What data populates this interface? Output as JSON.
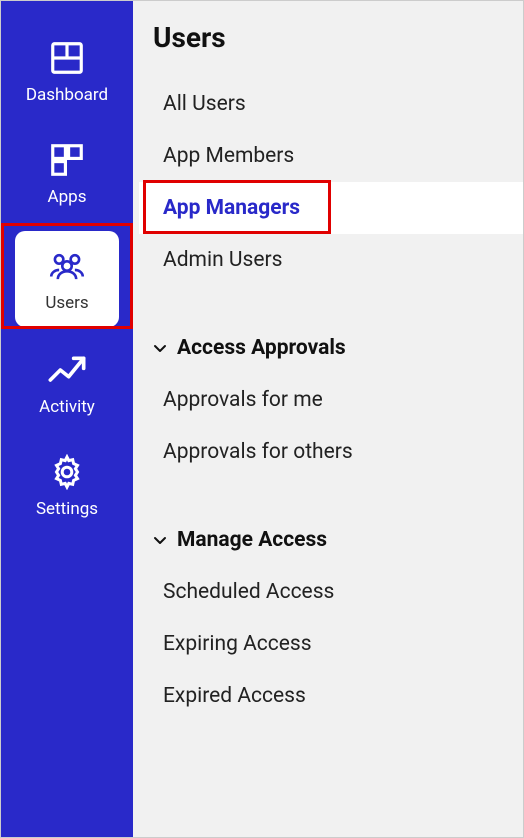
{
  "sidebar": {
    "items": [
      {
        "label": "Dashboard",
        "icon": "dashboard-icon"
      },
      {
        "label": "Apps",
        "icon": "apps-icon"
      },
      {
        "label": "Users",
        "icon": "users-icon",
        "active": true
      },
      {
        "label": "Activity",
        "icon": "activity-icon"
      },
      {
        "label": "Settings",
        "icon": "settings-icon"
      }
    ]
  },
  "content": {
    "title": "Users",
    "user_items": [
      {
        "label": "All Users"
      },
      {
        "label": "App Members"
      },
      {
        "label": "App Managers",
        "selected": true
      },
      {
        "label": "Admin Users"
      }
    ],
    "sections": [
      {
        "header": "Access Approvals",
        "items": [
          {
            "label": "Approvals for me"
          },
          {
            "label": "Approvals for others"
          }
        ]
      },
      {
        "header": "Manage Access",
        "items": [
          {
            "label": "Scheduled Access"
          },
          {
            "label": "Expiring Access"
          },
          {
            "label": "Expired Access"
          }
        ]
      }
    ]
  },
  "colors": {
    "sidebar_bg": "#2929c9",
    "content_bg": "#f1f1f1",
    "accent": "#2929c9",
    "highlight": "#e00000"
  }
}
